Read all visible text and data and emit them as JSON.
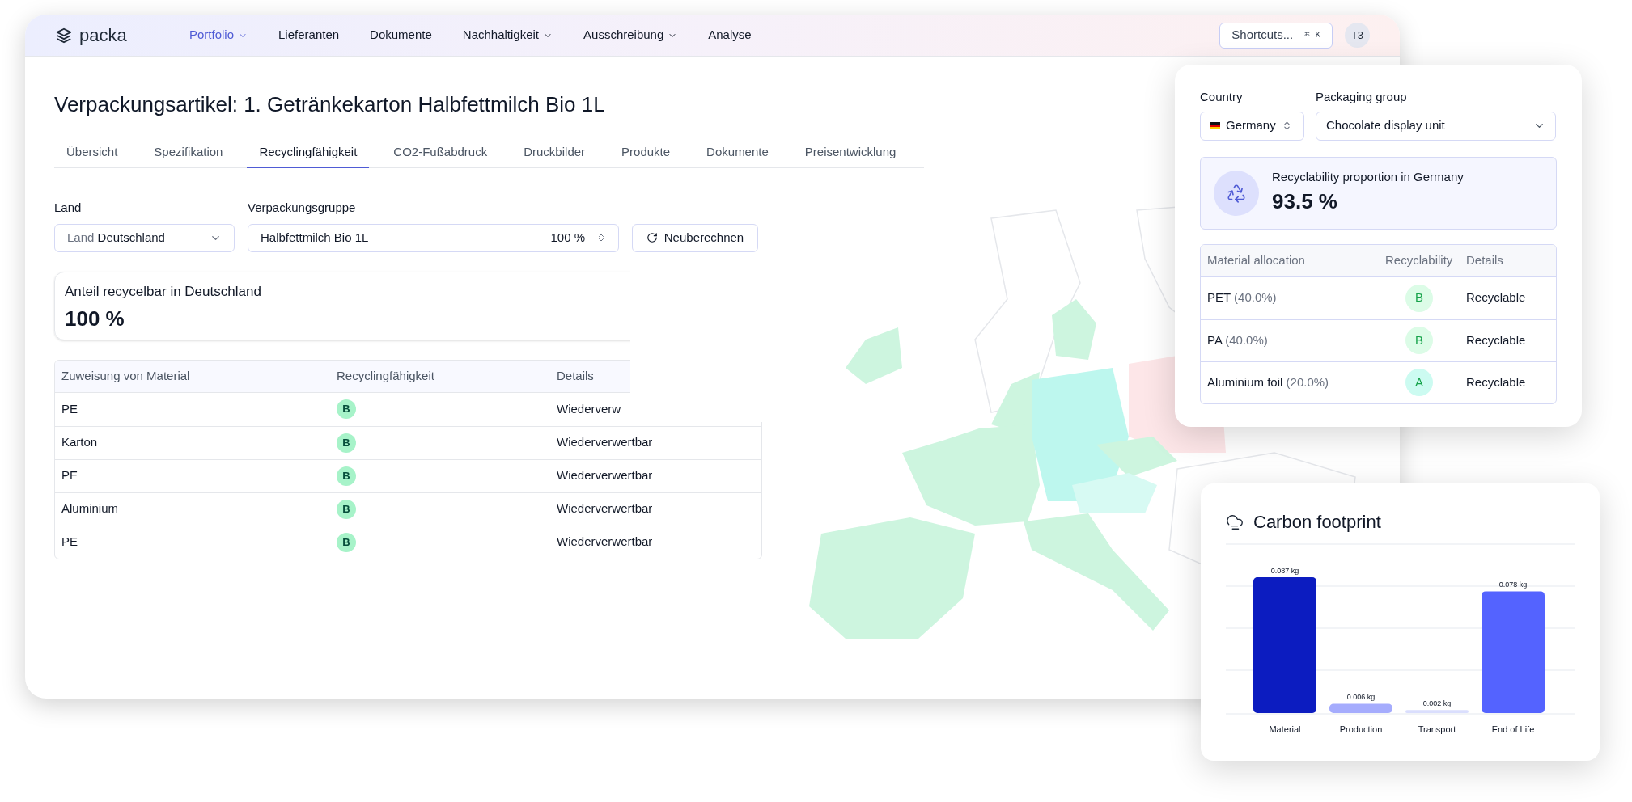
{
  "nav": {
    "logo": "packa",
    "items": [
      {
        "label": "Portfolio",
        "selected": true,
        "dropdown": true
      },
      {
        "label": "Lieferanten",
        "selected": false,
        "dropdown": false
      },
      {
        "label": "Dokumente",
        "selected": false,
        "dropdown": false
      },
      {
        "label": "Nachhaltigkeit",
        "selected": false,
        "dropdown": true
      },
      {
        "label": "Ausschreibung",
        "selected": false,
        "dropdown": true
      },
      {
        "label": "Analyse",
        "selected": false,
        "dropdown": false
      }
    ],
    "shortcuts": {
      "label": "Shortcuts...",
      "key": "⌘ K"
    },
    "avatar": "T3"
  },
  "page": {
    "title": "Verpackungsartikel: 1. Getränkekarton Halbfettmilch Bio 1L",
    "tabs": [
      {
        "label": "Übersicht",
        "selected": false
      },
      {
        "label": "Spezifikation",
        "selected": false
      },
      {
        "label": "Recyclingfähigkeit",
        "selected": true
      },
      {
        "label": "CO2-Fußabdruck",
        "selected": false
      },
      {
        "label": "Druckbilder",
        "selected": false
      },
      {
        "label": "Produkte",
        "selected": false
      },
      {
        "label": "Dokumente",
        "selected": false
      },
      {
        "label": "Preisentwicklung",
        "selected": false
      }
    ],
    "form": {
      "land_label": "Land",
      "land": {
        "prefix": "Land",
        "value": "Deutschland"
      },
      "group_label": "Verpackungsgruppe",
      "group": {
        "value": "Halbfettmilch Bio 1L",
        "percent": "100 %"
      },
      "recalc": "Neuberechnen"
    },
    "summary": {
      "label": "Anteil recycelbar in Deutschland",
      "value": "100 %"
    },
    "table": {
      "columns": [
        "Zuweisung von Material",
        "Recyclingfähigkeit",
        "Details"
      ],
      "rows": [
        {
          "material": "PE",
          "grade": "B",
          "details": "Wiederverw"
        },
        {
          "material": "Karton",
          "grade": "B",
          "details": "Wiederverwertbar"
        },
        {
          "material": "PE",
          "grade": "B",
          "details": "Wiederverwertbar"
        },
        {
          "material": "Aluminium",
          "grade": "B",
          "details": "Wiederverwertbar"
        },
        {
          "material": "PE",
          "grade": "B",
          "details": "Wiederverwertbar"
        }
      ]
    }
  },
  "recyclability_card": {
    "country_label": "Country",
    "country": "Germany",
    "group_label": "Packaging group",
    "group": "Chocolate display unit",
    "banner": {
      "label": "Recyclability proportion in Germany",
      "value": "93.5 %"
    },
    "table": {
      "columns": [
        "Material allocation",
        "Recyclability",
        "Details"
      ],
      "rows": [
        {
          "material": "PET",
          "share": "(40.0%)",
          "grade": "B",
          "color": "#dcfce7",
          "details": "Recyclable"
        },
        {
          "material": "PA",
          "share": "(40.0%)",
          "grade": "B",
          "color": "#dcfce7",
          "details": "Recyclable"
        },
        {
          "material": "Aluminium foil",
          "share": "(20.0%)",
          "grade": "A",
          "color": "#ccfbf1",
          "details": "Recyclable"
        }
      ]
    }
  },
  "carbon_card": {
    "title": "Carbon footprint",
    "chart_data": {
      "type": "bar",
      "categories": [
        "Material",
        "Production",
        "Transport",
        "End of Life"
      ],
      "series": [
        {
          "values": [
            0.087,
            0.006,
            0.002,
            0.078
          ],
          "colors": [
            "#0c1cc0",
            "#a5acfd",
            "#dadefd",
            "#5463ff"
          ],
          "value_labels": [
            "0.087 kg",
            "0.006 kg",
            "0.002 kg",
            "0.078 kg"
          ]
        }
      ]
    }
  }
}
